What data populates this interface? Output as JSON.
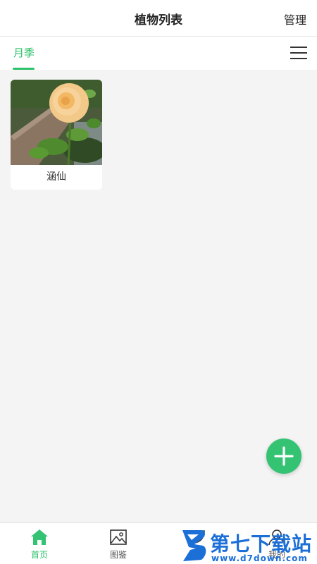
{
  "header": {
    "title": "植物列表",
    "manage_label": "管理"
  },
  "tabs": [
    {
      "label": "月季",
      "active": true
    }
  ],
  "plants": [
    {
      "name": "涵仙"
    }
  ],
  "fab": {
    "icon": "plus-icon"
  },
  "bottom_nav": [
    {
      "label": "首页",
      "icon": "home-icon",
      "active": true
    },
    {
      "label": "图鉴",
      "icon": "gallery-icon",
      "active": false
    },
    {
      "label": "",
      "icon": "leaf-icon",
      "active": false
    },
    {
      "label": "我的",
      "icon": "user-icon",
      "active": false
    }
  ],
  "watermark": {
    "name": "第七下载站",
    "url": "www.d7down.com"
  },
  "colors": {
    "accent": "#2ec06a",
    "fab": "#34c372",
    "background": "#f4f4f4",
    "watermark": "#1b6fd6"
  }
}
